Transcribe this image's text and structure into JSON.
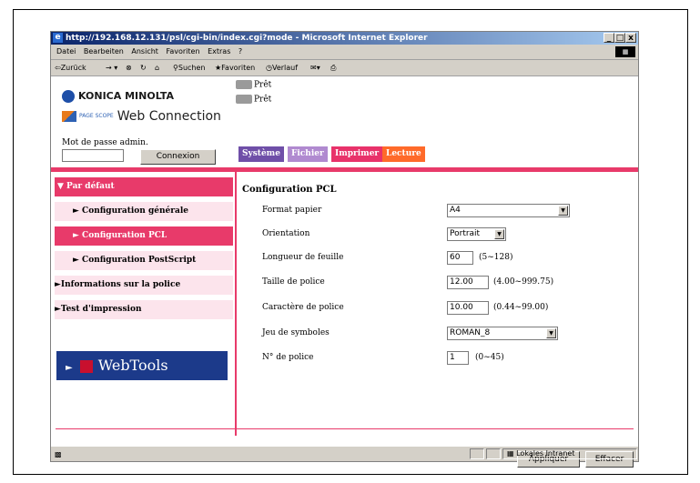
{
  "window": {
    "title": "http://192.168.12.131/psl/cgi-bin/index.cgi?mode - Microsoft Internet Explorer",
    "controls": [
      "_",
      "□",
      "x"
    ]
  },
  "menu": [
    "Datei",
    "Bearbeiten",
    "Ansicht",
    "Favoriten",
    "Extras",
    "?"
  ],
  "toolbar": {
    "back": "⇦Zurück",
    "search": "Suchen",
    "favorites": "Favoriten",
    "history": "Verlauf"
  },
  "brand": {
    "company": "KONICA MINOLTA",
    "product_small": "PAGE SCOPE",
    "product": "Web Connection"
  },
  "status": [
    "Prêt",
    "Prêt"
  ],
  "login": {
    "label": "Mot de passe admin.",
    "button": "Connexion"
  },
  "tabs": [
    {
      "label": "Système",
      "color": "#6f4fa8"
    },
    {
      "label": "Fichier",
      "color": "#b08ad0"
    },
    {
      "label": "Imprimer",
      "color": "#e8326a"
    },
    {
      "label": "Lecture",
      "color": "#ff6a2a"
    }
  ],
  "sidebar": {
    "items": [
      {
        "label": "▼ Par défaut"
      },
      {
        "label": "► Configuration générale"
      },
      {
        "label": "► Configuration PCL"
      },
      {
        "label": "► Configuration PostScript"
      },
      {
        "label": "►Informations sur la police"
      },
      {
        "label": "►Test d'impression"
      }
    ],
    "webtools": "WebTools",
    "webtools_arrow": "►"
  },
  "form": {
    "title": "Configuration PCL",
    "fields": [
      {
        "label": "Format papier",
        "value": "A4"
      },
      {
        "label": "Orientation",
        "value": "Portrait"
      },
      {
        "label": "Longueur de feuille",
        "value": "60",
        "range": "(5~128)"
      },
      {
        "label": "Taille de police",
        "value": "12.00",
        "range": "(4.00~999.75)"
      },
      {
        "label": "Caractère de police",
        "value": "10.00",
        "range": "(0.44~99.00)"
      },
      {
        "label": "Jeu de symboles",
        "value": "ROMAN_8"
      },
      {
        "label": "N° de police",
        "value": "1",
        "range": "(0~45)"
      }
    ]
  },
  "actions": {
    "apply": "Appliquer",
    "clear": "Effacer"
  },
  "statusbar": {
    "zone": "Lokales Intranet"
  },
  "colors": {
    "accent": "#e83a6a",
    "sidebar_bg": "#fce4ec",
    "sidebar_active": "#e83a6a",
    "webtools_bg": "#1c3a8a"
  }
}
